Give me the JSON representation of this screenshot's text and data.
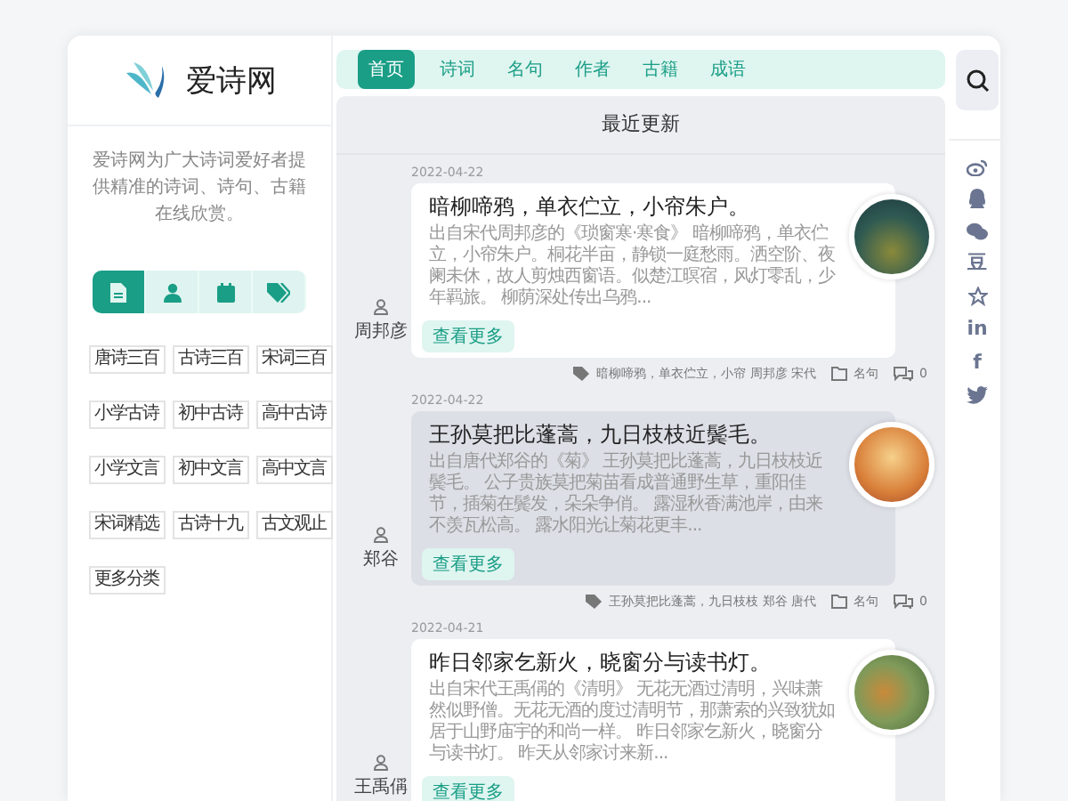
{
  "site": {
    "name": "爱诗网",
    "description": "爱诗网为广大诗词爱好者提供精准的诗词、诗句、古籍在线欣赏。"
  },
  "sidebar_tabs": [
    {
      "kind": "document",
      "selected": true
    },
    {
      "kind": "user",
      "selected": false
    },
    {
      "kind": "calendar",
      "selected": false
    },
    {
      "kind": "tag",
      "selected": false
    }
  ],
  "categories": [
    "唐诗三百",
    "古诗三百",
    "宋词三百",
    "小学古诗",
    "初中古诗",
    "高中古诗",
    "小学文言",
    "初中文言",
    "高中文言",
    "宋词精选",
    "古诗十九",
    "古文观止",
    "更多分类"
  ],
  "nav": [
    {
      "label": "首页",
      "selected": true
    },
    {
      "label": "诗词",
      "selected": false
    },
    {
      "label": "名句",
      "selected": false
    },
    {
      "label": "作者",
      "selected": false
    },
    {
      "label": "古籍",
      "selected": false
    },
    {
      "label": "成语",
      "selected": false
    }
  ],
  "section_title": "最近更新",
  "posts": [
    {
      "date": "2022-04-22",
      "author": "周邦彦",
      "title": "暗柳啼鸦，单衣伫立，小帘朱户。",
      "excerpt": "出自宋代周邦彦的《琐窗寒·寒食》 暗柳啼鸦，单衣伫立，小帘朱户。桐花半亩，静锁一庭愁雨。洒空阶、夜阑未休，故人剪烛西窗语。似楚江暝宿，风灯零乱，少年羁旅。 柳荫深处传出乌鸦...",
      "button": "查看更多",
      "highlighted": false,
      "tags": "暗柳啼鸦，单衣伫立，小帘 周邦彦 宋代",
      "category": "名句",
      "comments": "0"
    },
    {
      "date": "2022-04-22",
      "author": "郑谷",
      "title": "王孙莫把比蓬蒿，九日枝枝近鬓毛。",
      "excerpt": "出自唐代郑谷的《菊》 王孙莫把比蓬蒿，九日枝枝近鬓毛。 公子贵族莫把菊苗看成普通野生草，重阳佳节，插菊在鬓发，朵朵争俏。 露湿秋香满池岸，由来不羡瓦松高。 露水阳光让菊花更丰...",
      "button": "查看更多",
      "highlighted": true,
      "tags": "王孙莫把比蓬蒿，九日枝枝 郑谷 唐代",
      "category": "名句",
      "comments": "0"
    },
    {
      "date": "2022-04-21",
      "author": "王禹偁",
      "title": "昨日邻家乞新火，晓窗分与读书灯。",
      "excerpt": "出自宋代王禹偁的《清明》 无花无酒过清明，兴味萧然似野僧。无花无酒的度过清明节，那萧索的兴致犹如居于山野庙宇的和尚一样。 昨日邻家乞新火，晓窗分与读书灯。 昨天从邻家讨来新...",
      "button": "查看更多",
      "highlighted": false
    }
  ],
  "social": [
    {
      "kind": "weibo"
    },
    {
      "kind": "qq"
    },
    {
      "kind": "wechat"
    },
    {
      "kind": "text",
      "label": "豆"
    },
    {
      "kind": "star"
    },
    {
      "kind": "text",
      "label": "in"
    },
    {
      "kind": "text",
      "label": "f"
    },
    {
      "kind": "twitter"
    }
  ]
}
